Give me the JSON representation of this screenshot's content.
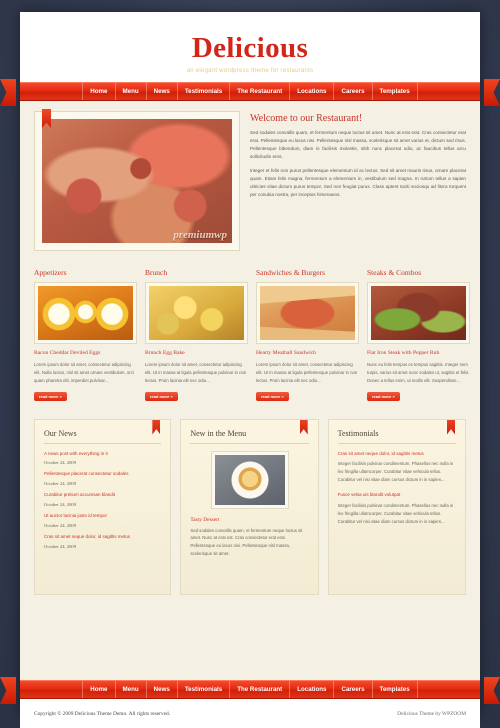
{
  "site": {
    "logo": "Delicious",
    "tagline": "an elegant wordpress theme for restaurants",
    "accent_red": "#d32518",
    "page_bg": "#39415a",
    "content_bg": "#f4f0e4"
  },
  "nav": {
    "items": [
      {
        "label": "Home"
      },
      {
        "label": "Menu"
      },
      {
        "label": "News"
      },
      {
        "label": "Testimonials"
      },
      {
        "label": "The Restaurant"
      },
      {
        "label": "Locations"
      },
      {
        "label": "Careers"
      },
      {
        "label": "Templates"
      }
    ]
  },
  "hero": {
    "image_watermark": "premiumwp",
    "title": "Welcome to our Restaurant!",
    "paragraph1": "Sed sodales convallis quam, et fermentum neque luctus sit amet. Nunc at erat erat. Cras consectetur erat erat. Pellentesque eu lacus nisi. Pellentesque nisl massa, scelerisque sit amet varius et, dictum sed risus. Pellentesque bibendum, diam in facilisis molestie, nibh nunc placerat odio, ac faucibus tellus arcu sollicitudin eros.",
    "paragraph2": "Integer et felis non purus pellentesque elementum id ac lectus. Sed sit amet mauris risus, ornare placerat quam. Etiam felis magna, fermentum a elementum in, vestibulum sed magna. In rutrum tellus a sapien ultricies vitae dictum purus tempor. Sed non feugiat purus. Class aptent taciti sociosqu ad litora torquent per conubia nostra, per inceptos himenaeos."
  },
  "categories": [
    {
      "heading": "Appetizers",
      "image": "deviled-eggs-photo",
      "item_title": "Bacon Cheddar Deviled Eggs",
      "item_text": "Lorem ipsum dolor sit amet, consectetur adipiscing elit. Nulla luctus, nisl sit amet ornare vestibulum, orci quam pharetra elit, imperdiet pulvinar...",
      "button": "read more »"
    },
    {
      "heading": "Brunch",
      "image": "egg-bake-photo",
      "item_title": "Brunch Egg Bake",
      "item_text": "Lorem ipsum dolor sit amet, consectetur adipiscing elit. Ut in massa at ligula pellentesque pulvinar in non lectus. Proin lacinia elit nec odio...",
      "button": "read more »"
    },
    {
      "heading": "Sandwiches & Burgers",
      "image": "meatball-sandwich-photo",
      "item_title": "Hearty Meatball Sandwich",
      "item_text": "Lorem ipsum dolor sit amet, consectetur adipiscing elit. Ut in massa at ligula pellentesque pulvinar in non lectus. Proin lacinia elit nec odio...",
      "button": "read more »"
    },
    {
      "heading": "Steaks & Combos",
      "image": "flat-iron-steak-photo",
      "item_title": "Flat Iron Steak with Pepper Rub",
      "item_text": "Nunc eu felis tempus ex tempus sagittis. Integer sem turpis, varius sit amet nunc sodales ut, sagittis et felis. Donec a tellus enim, ut mollis elit. Suspendisse...",
      "button": "read more »"
    }
  ],
  "panels": {
    "news": {
      "title": "Our News",
      "items": [
        {
          "link": "A news post with everything in it",
          "date": "October 24, 2009"
        },
        {
          "link": "Pellentesque placerat consectetur sodales",
          "date": "October 24, 2009"
        },
        {
          "link": "Curabitur pretium accumsan blandit",
          "date": "October 24, 2009"
        },
        {
          "link": "Ut auctor lacinia justo id tempor",
          "date": "October 24, 2009"
        },
        {
          "link": "Cras sit amet neque dolor, id sagittis metus",
          "date": "October 24, 2009"
        }
      ]
    },
    "menu": {
      "title": "New in the Menu",
      "image": "tasty-dessert-photo",
      "item_title": "Tasty Dessert",
      "item_text": "Sed sodales convallis quam, et fermentum neque luctus sit amet. Nunc at erat est. Cras consectetur erat erat. Pellentesque eu lacus nisi. Pellentesque nisl massa, scelerisque sit amet."
    },
    "testimonials": {
      "title": "Testimonials",
      "items": [
        {
          "heading": "Cras sit amet neque dolor, id sagittis metus",
          "body": "Integer facilisis pulvinar condimentum. Phasellus nec nulla in leo fringilla ullamcorper. Curabitur vitae vehicula tellus. Curabitur vel nisi vitae diam cursus dictum in in sapien..."
        },
        {
          "heading": "Fusce velsa uis blandit volutpat",
          "body": "Integer facilisis pulvinar condimentum. Phasellus nec nulla in leo fringilla ullamcorper. Curabitur vitae vehicula tellus. Curabitur vel nisi vitae diam cursus dictum in in sapien..."
        }
      ]
    }
  },
  "footer": {
    "copyright": "Copyright © 2009 Delicious Theme Demo. All rights reserved.",
    "credit": "Delicious Theme by WPZOOM"
  }
}
